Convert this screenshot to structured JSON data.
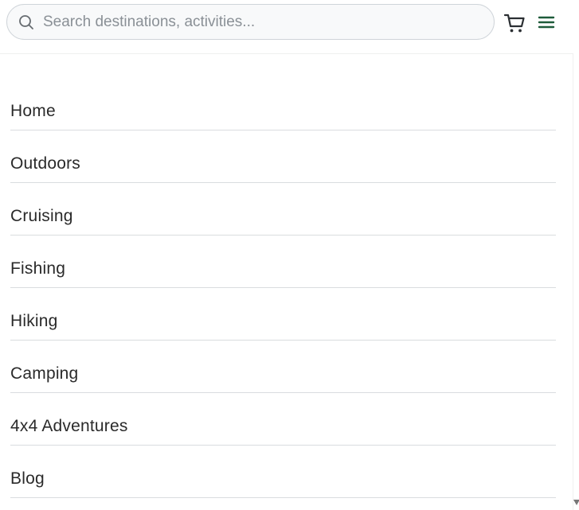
{
  "search": {
    "placeholder": "Search destinations, activities..."
  },
  "header": {
    "cart_icon": "shopping-cart-icon",
    "menu_icon": "hamburger-menu-icon",
    "accent_color": "#1e5b3a"
  },
  "nav": {
    "items": [
      {
        "label": "Home"
      },
      {
        "label": "Outdoors"
      },
      {
        "label": "Cruising"
      },
      {
        "label": "Fishing"
      },
      {
        "label": "Hiking"
      },
      {
        "label": "Camping"
      },
      {
        "label": "4x4 Adventures"
      },
      {
        "label": "Blog"
      }
    ]
  }
}
